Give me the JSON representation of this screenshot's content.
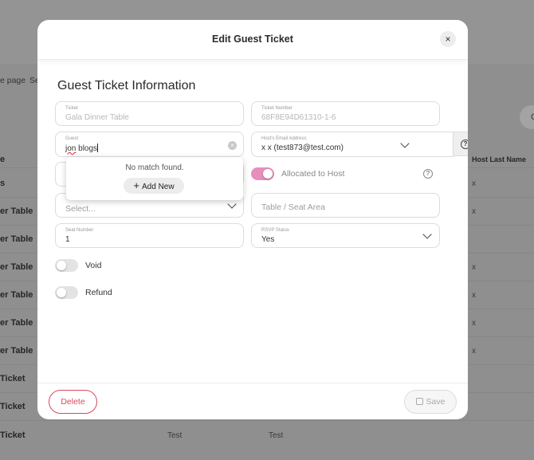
{
  "background": {
    "breadcrumb_fragment": "e page",
    "breadcrumb_fragment2": "Se",
    "column_fragment": "e",
    "right_column_header": "Host Last Name",
    "circle_label": "C",
    "rows": [
      {
        "label": "s",
        "host_last": "x"
      },
      {
        "label": "er Table",
        "host_last": "x"
      },
      {
        "label": "er Table",
        "host_last": ""
      },
      {
        "label": "er Table",
        "host_last": "x"
      },
      {
        "label": "er Table",
        "host_last": "x"
      },
      {
        "label": "er Table",
        "host_last": "x"
      },
      {
        "label": "er Table",
        "host_last": "x"
      },
      {
        "label": "Ticket",
        "host_last": ""
      },
      {
        "label": "Ticket",
        "host_last": ""
      },
      {
        "label": "Ticket",
        "col1": "Test",
        "col2": "Test"
      }
    ]
  },
  "modal": {
    "title": "Edit Guest Ticket",
    "close_icon": "×",
    "section_title": "Guest Ticket Information",
    "ticket": {
      "label": "Ticket",
      "value": "Gala Dinner Table"
    },
    "ticket_number": {
      "label": "Ticket Number",
      "value": "68F8E94D61310-1-6"
    },
    "guest": {
      "label": "Guest",
      "value_misspelled": "jon",
      "value_rest": " blogs"
    },
    "host_email": {
      "label": "Host's Email Address",
      "value": "x x (test873@test.com)"
    },
    "dropdown": {
      "no_match": "No match found.",
      "add_new": "Add New",
      "add_icon": "+"
    },
    "allocated_to_host": {
      "label": "Allocated to Host",
      "on": true
    },
    "select": {
      "placeholder": "Select..."
    },
    "table_seat_area": {
      "placeholder": "Table / Seat Area"
    },
    "seat_number": {
      "label": "Seat Number",
      "value": "1"
    },
    "rsvp_status": {
      "label": "RSVP Status",
      "value": "Yes"
    },
    "void": {
      "label": "Void",
      "on": false
    },
    "refund": {
      "label": "Refund",
      "on": false
    },
    "help_icon": "?",
    "clear_icon": "×",
    "delete_label": "Delete",
    "save_label": "Save"
  },
  "colors": {
    "accent_pink": "#e58fbd",
    "danger": "#d8495b"
  }
}
